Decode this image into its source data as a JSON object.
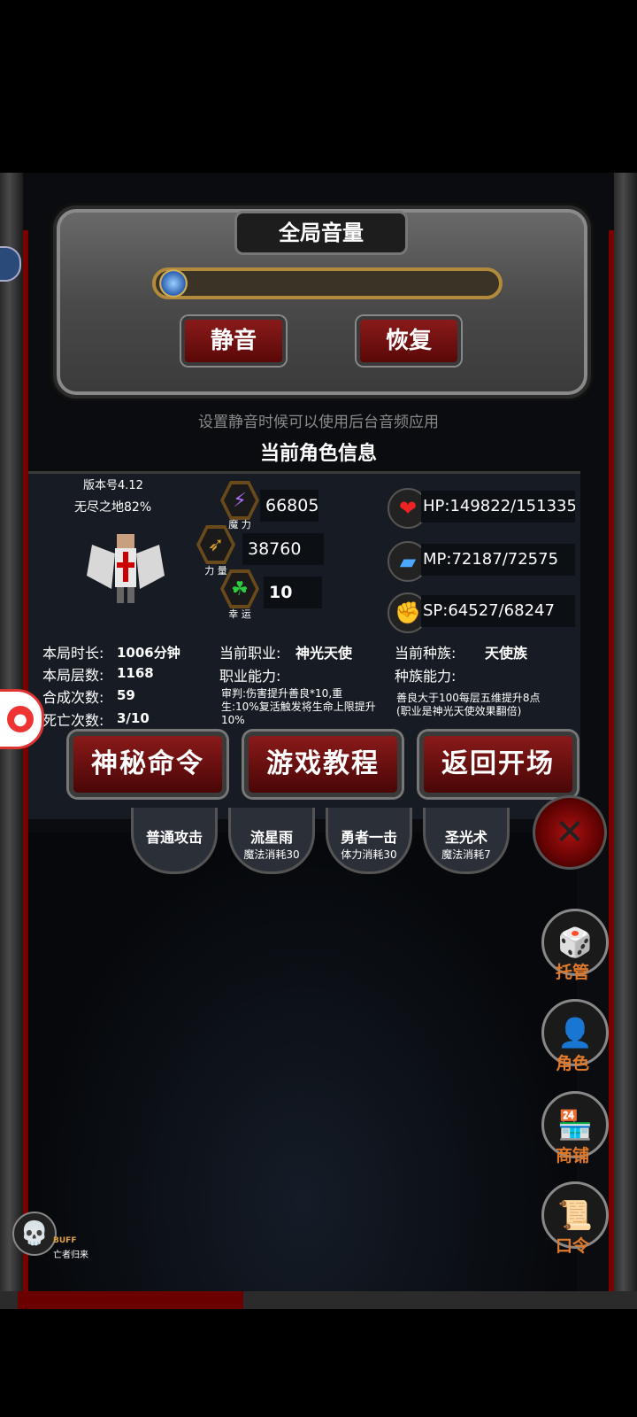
{
  "volume": {
    "title": "全局音量",
    "level_percent": 0,
    "mute_label": "静音",
    "restore_label": "恢复",
    "hint": "设置静音时候可以使用后台音频应用"
  },
  "character": {
    "section_title": "当前角色信息",
    "version": "版本号4.12",
    "endless": "无尽之地82%",
    "magic_value": "66805",
    "magic_label": "魔 力",
    "power_value": "38760",
    "power_label": "力 量",
    "luck_value": "10",
    "luck_label": "幸 运",
    "hp": "HP:149822/151335",
    "mp": "MP:72187/72575",
    "sp": "SP:64527/68247",
    "duration_label": "本局时长:",
    "duration_value": "1006分钟",
    "floors_label": "本局层数:",
    "floors_value": "1168",
    "merges_label": "合成次数:",
    "merges_value": "59",
    "deaths_label": "死亡次数:",
    "deaths_value": "3/10",
    "job_label": "当前职业:",
    "job_value": "神光天使",
    "job_ability_label": "职业能力:",
    "job_ability_desc": "审判:伤害提升善良*10,重生:10%复活触发将生命上限提升10%",
    "race_label": "当前种族:",
    "race_value": "天使族",
    "race_ability_label": "种族能力:",
    "race_ability_desc": "善良大于100每层五维提升8点(职业是神光天使效果翻倍)"
  },
  "buttons": {
    "mystery": "神秘命令",
    "tutorial": "游戏教程",
    "back": "返回开场"
  },
  "skills": [
    {
      "name": "普通攻击",
      "cost": ""
    },
    {
      "name": "流星雨",
      "cost": "魔法消耗30"
    },
    {
      "name": "勇者一击",
      "cost": "体力消耗30"
    },
    {
      "name": "圣光术",
      "cost": "魔法消耗7"
    }
  ],
  "side": {
    "auto": "托管",
    "role": "角色",
    "shop": "商铺",
    "code": "口令"
  },
  "buff": {
    "tag": "BUFF",
    "name": "亡者归来"
  },
  "colors": {
    "accent_red": "#8a1a1a",
    "side_label": "#e07a2a",
    "gold": "#b28a3c"
  }
}
